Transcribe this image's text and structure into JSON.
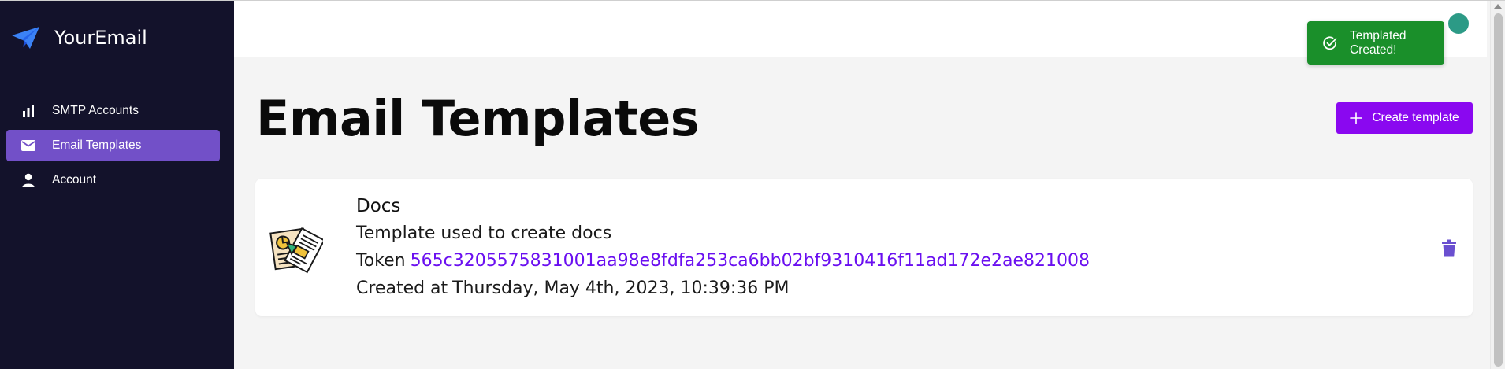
{
  "app": {
    "name": "YourEmail"
  },
  "sidebar": {
    "items": [
      {
        "label": "SMTP Accounts",
        "icon": "bar-chart-icon",
        "active": false
      },
      {
        "label": "Email Templates",
        "icon": "mail-icon",
        "active": true
      },
      {
        "label": "Account",
        "icon": "person-icon",
        "active": false
      }
    ]
  },
  "toast": {
    "message": "Templated Created!",
    "icon": "check-circle-icon",
    "color": "#1a8f2a"
  },
  "main": {
    "title": "Email Templates",
    "create_button_label": "Create template"
  },
  "templates": [
    {
      "name": "Docs",
      "description": "Template used to create docs",
      "token_label": "Token",
      "token": "565c3205575831001aa98e8fdfa253ca6bb02bf9310416f11ad172e2ae821008",
      "created_label": "Created at",
      "created_at": "Thursday, May 4th, 2023, 10:39:36 PM"
    }
  ],
  "colors": {
    "sidebar_bg": "#13122b",
    "active_item": "#7250c8",
    "accent": "#8a08f0",
    "token_link": "#6a0ff0",
    "delete": "#6a4fd0",
    "toast": "#1a8f2a"
  }
}
